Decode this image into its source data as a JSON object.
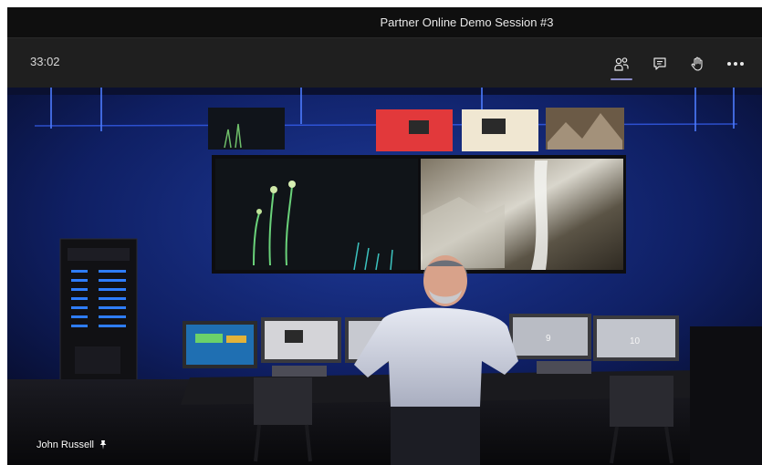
{
  "window": {
    "title": "Partner Online Demo Session #3"
  },
  "toolbar": {
    "timer": "33:02",
    "buttons": [
      {
        "icon": "people-icon",
        "active": true
      },
      {
        "icon": "chat-icon",
        "active": false
      },
      {
        "icon": "raise-hand-icon",
        "active": false
      },
      {
        "icon": "more-options-icon",
        "active": false
      }
    ]
  },
  "video": {
    "participant_name": "John Russell",
    "pin_icon": "pin-icon",
    "screen_labels": {
      "left_monitor_9": "9",
      "right_monitor_10": "10"
    }
  },
  "colors": {
    "titlebar": "#0f0f0f",
    "toolbar": "#1f1f1f",
    "accent": "#8b8cc7",
    "room_blue": "#0b1640"
  }
}
